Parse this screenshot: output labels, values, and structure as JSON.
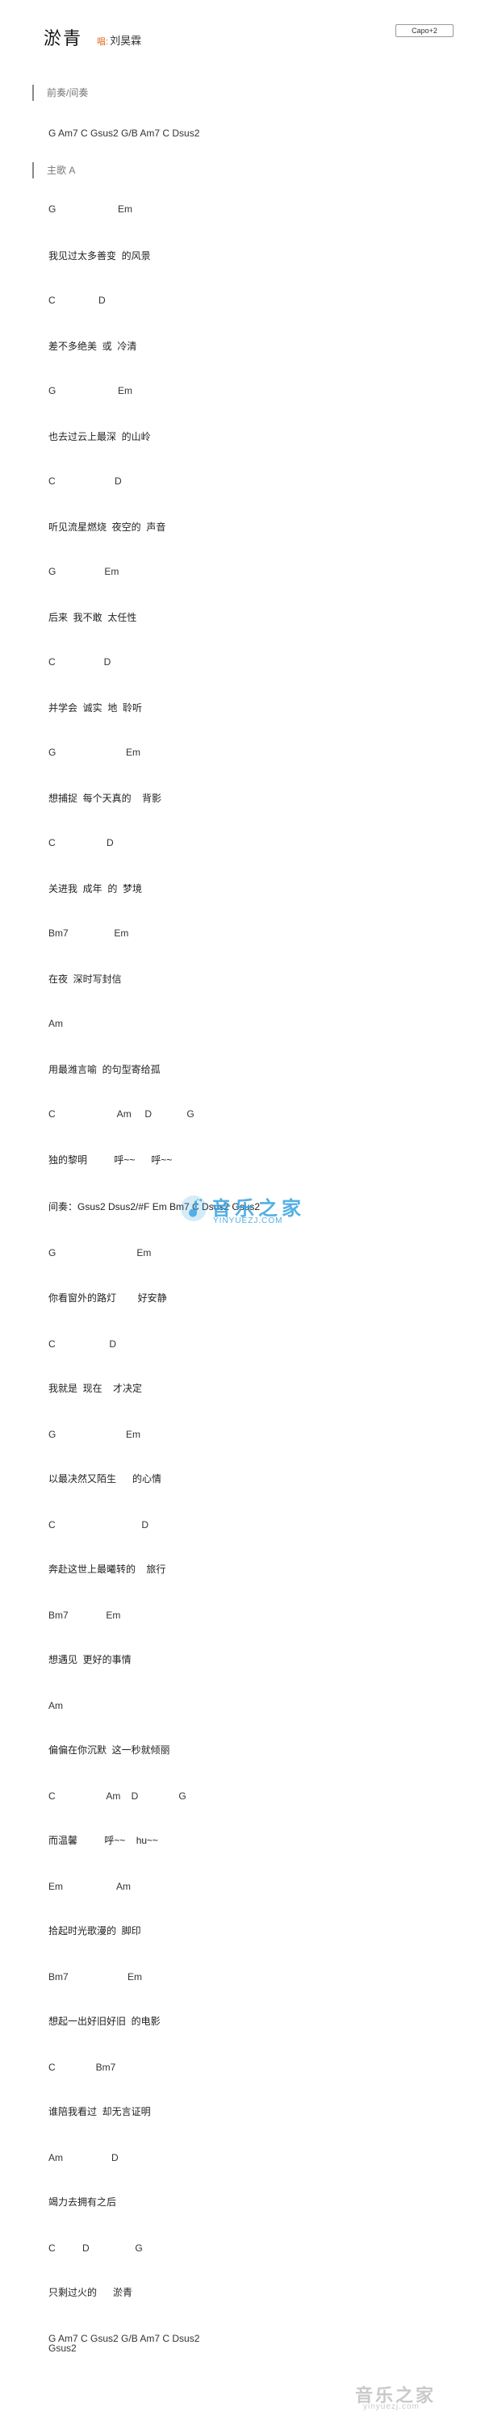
{
  "header": {
    "title": "淤青",
    "singer_label": "唱:",
    "singer": "刘昊霖",
    "capo": "Capo+2"
  },
  "sections": [
    {
      "label": "前奏/间奏"
    },
    {
      "label": "主歌 A"
    }
  ],
  "lines": [
    "G Am7 C Gsus2 G/B Am7 C Dsus2",
    "G                       Em",
    "我见过太多善变  的风景",
    "C                D",
    "差不多绝美  或  冷清",
    "G                       Em",
    "也去过云上最深  的山岭",
    "C                      D",
    "听见流星燃烧  夜空的  声音",
    "G                  Em",
    "后来  我不敢  太任性",
    "C                  D",
    "并学会  诚实  地  聆听",
    "G                          Em",
    "想捕捉  每个天真的    背影",
    "C                   D",
    "关进我  成年  的  梦境",
    "Bm7                 Em",
    "在夜  深时写封信",
    "Am",
    "用最潍言喻  的句型寄给孤",
    "C                       Am     D             G",
    "独的黎明          呼~~      呼~~",
    "间奏：Gsus2 Dsus2/#F Em Bm7 C Dsus2 Gsus2",
    "G                              Em",
    "你看窗外的路灯        好安静",
    "C                    D",
    "我就是  现在    才决定",
    "G                          Em",
    "以最决然又陌生      的心情",
    "C                                D",
    "奔赴这世上最曦转的    旅行",
    "Bm7              Em",
    "想遇见  更好的事情",
    "Am",
    "偏偏在你沉默  这一秒就倾丽",
    "C                   Am    D               G",
    "而温馨          呼~~    hu~~",
    "Em                    Am",
    "拾起时光歌漫的  脚印",
    "Bm7                      Em",
    "想起一出好旧好旧  的电影",
    "C               Bm7",
    "谁陪我看过  却无言证明",
    "Am                  D",
    "竭力去拥有之后",
    "C          D                 G",
    "只剩过火的      淤青",
    "G Am7 C Gsus2 G/B Am7 C Dsus2",
    "Gsus2"
  ],
  "watermark": {
    "text": "音乐之家",
    "url": "YINYUEZJ.COM"
  },
  "footer": {
    "text": "音乐之家",
    "url": "yinyuezj.com"
  }
}
